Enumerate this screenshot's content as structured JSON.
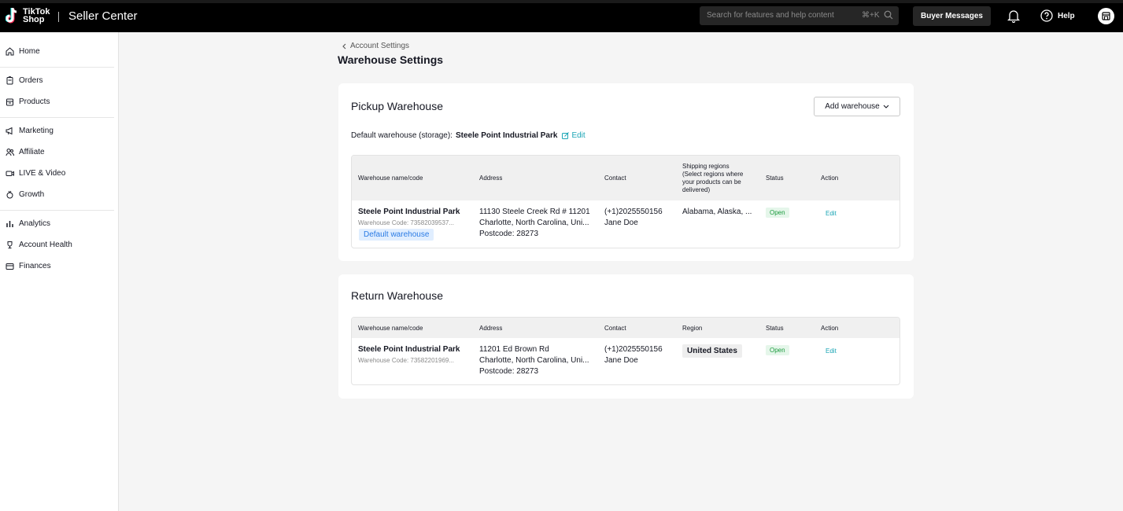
{
  "topbar": {
    "logo_line1": "TikTok",
    "logo_line2": "Shop",
    "app_title": "Seller Center",
    "search_placeholder": "Search for features and help content",
    "search_shortcut": "⌘+K",
    "buyer_messages": "Buyer Messages",
    "help": "Help"
  },
  "sidebar": {
    "items": [
      {
        "label": "Home",
        "icon": "home-icon"
      },
      {
        "label": "Orders",
        "icon": "orders-icon"
      },
      {
        "label": "Products",
        "icon": "products-icon"
      },
      {
        "label": "Marketing",
        "icon": "megaphone-icon"
      },
      {
        "label": "Affiliate",
        "icon": "people-icon"
      },
      {
        "label": "LIVE & Video",
        "icon": "video-icon"
      },
      {
        "label": "Growth",
        "icon": "growth-icon"
      },
      {
        "label": "Analytics",
        "icon": "analytics-icon"
      },
      {
        "label": "Account Health",
        "icon": "trophy-icon"
      },
      {
        "label": "Finances",
        "icon": "wallet-icon"
      }
    ]
  },
  "breadcrumb": "Account Settings",
  "page_title": "Warehouse Settings",
  "pickup": {
    "title": "Pickup Warehouse",
    "add_button": "Add warehouse",
    "default_label": "Default warehouse (storage):",
    "default_name": "Steele Point Industrial Park",
    "edit": "Edit",
    "headers": {
      "name": "Warehouse name/code",
      "address": "Address",
      "contact": "Contact",
      "regions_1": "Shipping regions",
      "regions_2": "(Select regions where",
      "regions_3": "your products can be",
      "regions_4": "delivered)",
      "status": "Status",
      "action": "Action"
    },
    "row": {
      "name": "Steele Point Industrial Park",
      "code": "Warehouse Code: 73582039537...",
      "default_badge": "Default warehouse",
      "address_1": "11130 Steele Creek Rd # 11201",
      "address_2": "Charlotte, North Carolina, Uni...",
      "address_3": "Postcode: 28273",
      "phone": "(+1)2025550156",
      "person": "Jane Doe",
      "regions": "Alabama, Alaska, ...",
      "status": "Open",
      "action": "Edit"
    }
  },
  "return": {
    "title": "Return Warehouse",
    "headers": {
      "name": "Warehouse name/code",
      "address": "Address",
      "contact": "Contact",
      "region": "Region",
      "status": "Status",
      "action": "Action"
    },
    "row": {
      "name": "Steele Point Industrial Park",
      "code": "Warehouse Code: 73582201969...",
      "address_1": "11201 Ed Brown Rd",
      "address_2": "Charlotte, North Carolina, Uni...",
      "address_3": "Postcode: 28273",
      "phone": "(+1)2025550156",
      "person": "Jane Doe",
      "region": "United States",
      "status": "Open",
      "action": "Edit"
    }
  }
}
